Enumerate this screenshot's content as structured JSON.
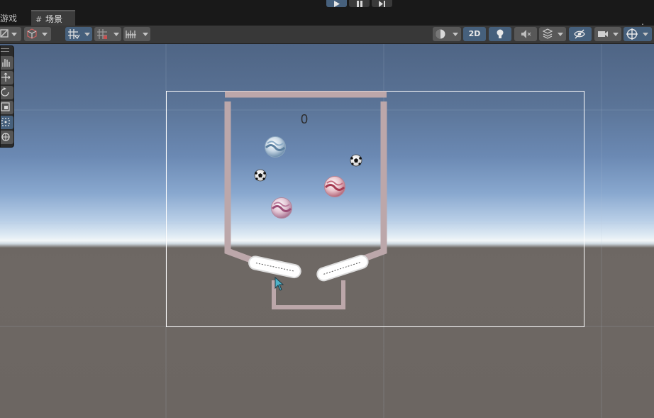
{
  "play_controls": [
    {
      "id": "play",
      "icon": "play-icon",
      "active": true
    },
    {
      "id": "pause",
      "icon": "pause-icon",
      "active": false
    },
    {
      "id": "step",
      "icon": "step-icon",
      "active": false
    }
  ],
  "tabs": {
    "game_label": "游戏",
    "scene_label": "场景",
    "scene_icon": "grid-icon",
    "menu_icon": "kebab-menu-icon"
  },
  "toolbar": {
    "draw_mode_icon": "draw-mode-icon",
    "orientation_icon": "orientation-cube-icon",
    "grid_toggle_icon": "grid-snapping-icon",
    "snap_icon": "increment-snap-icon",
    "ruler_icon": "ruler-icon",
    "shading_icon": "shading-sphere-icon",
    "mode_2d_label": "2D",
    "lighting_icon": "light-bulb-icon",
    "audio_icon": "mute-audio-icon",
    "effects_icon": "effects-icon",
    "visibility_icon": "hidden-eye-icon",
    "camera_icon": "camera-icon",
    "gizmos_icon": "gizmos-icon"
  },
  "tools": [
    {
      "name": "hand-tool",
      "icon": "hand-icon",
      "active": false
    },
    {
      "name": "move-tool",
      "icon": "move-icon",
      "active": false
    },
    {
      "name": "rotate-tool",
      "icon": "rotate-icon",
      "active": false
    },
    {
      "name": "scale-tool",
      "icon": "scale-icon",
      "active": false
    },
    {
      "name": "rect-tool",
      "icon": "rect-transform-icon",
      "active": true
    },
    {
      "name": "transform-tool",
      "icon": "transform-icon",
      "active": false
    }
  ],
  "scene": {
    "score_text": "0",
    "colors": {
      "wall": "#bca7aa",
      "camera_frame": "#ffffff",
      "sky_top": "#4f6585",
      "horizon": "#f2f6f8",
      "ground": "#6c6662"
    },
    "balls": [
      {
        "kind": "marble",
        "tint": "blue"
      },
      {
        "kind": "marble",
        "tint": "red"
      },
      {
        "kind": "marble",
        "tint": "pink"
      },
      {
        "kind": "soccer-ball"
      },
      {
        "kind": "soccer-ball"
      }
    ],
    "flippers": [
      "left-flipper",
      "right-flipper"
    ]
  }
}
